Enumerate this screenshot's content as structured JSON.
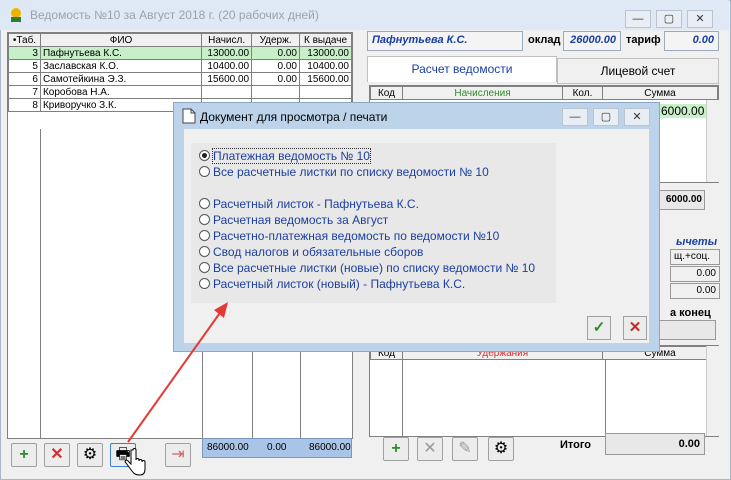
{
  "window": {
    "title": "Ведомость №10 за Август 2018 г. (20 рабочих дней)",
    "controls": [
      "—",
      "▢",
      "✕"
    ]
  },
  "left_table": {
    "headers": [
      "•Таб.",
      "ФИО",
      "Начисл.",
      "Удерж.",
      "К выдаче"
    ],
    "rows": [
      {
        "tab": "3",
        "name": "Пафнутьева К.С.",
        "acc": "13000.00",
        "ded": "0.00",
        "pay": "13000.00"
      },
      {
        "tab": "5",
        "name": "Заславская К.О.",
        "acc": "10400.00",
        "ded": "0.00",
        "pay": "10400.00"
      },
      {
        "tab": "6",
        "name": "Самотейкина Э.З.",
        "acc": "15600.00",
        "ded": "0.00",
        "pay": "15600.00"
      },
      {
        "tab": "7",
        "name": "Коробова Н.А.",
        "acc": "",
        "ded": "",
        "pay": ""
      },
      {
        "tab": "8",
        "name": "Криворучко З.К.",
        "acc": "",
        "ded": "",
        "pay": ""
      }
    ],
    "totals": {
      "acc": "86000.00",
      "ded": "0.00",
      "pay": "86000.00"
    }
  },
  "right_panel": {
    "employee": "Пафнутьева К.С.",
    "salary_label": "оклад",
    "salary": "26000.00",
    "rate_label": "тариф",
    "rate": "0.00",
    "tabs": [
      "Расчет ведомости",
      "Лицевой счет"
    ],
    "accruals_headers": [
      "Код",
      "Начисления",
      "Кол.",
      "Сумма"
    ],
    "accrual_value": "6000.00",
    "accrual_total": "6000.00",
    "deductions_label": "ычеты",
    "social_label": "щ.+соц.",
    "zero1": "0.00",
    "zero2": "0.00",
    "end_label": "а конец",
    "deductions_headers": [
      "Код",
      "Удержания",
      "Сумма"
    ],
    "total_label": "Итого",
    "total_value": "0.00"
  },
  "dialog": {
    "title": "Документ для  просмотра / печати",
    "options": [
      {
        "label": "Платежная ведомость № 10",
        "selected": true
      },
      {
        "label": "Все расчетные листки по списку ведомости № 10",
        "selected": false
      },
      {
        "label": "Расчетный листок - Пафнутьева К.С.",
        "selected": false
      },
      {
        "label": "Расчетная ведомость за Август",
        "selected": false
      },
      {
        "label": "Расчетно-платежная ведомость по ведомости №10",
        "selected": false
      },
      {
        "label": "Свод налогов и обязательные сборов",
        "selected": false
      },
      {
        "label": "Все расчетные листки (новые) по списку ведомости № 10",
        "selected": false
      },
      {
        "label": "Расчетный листок (новый) - Пафнутьева К.С.",
        "selected": false
      }
    ]
  },
  "colors": {
    "accent_blue": "#1a3fa0",
    "selected_row": "#c8f0c8",
    "arrow": "#e53935",
    "totals_bg": "#a9c4e6"
  }
}
